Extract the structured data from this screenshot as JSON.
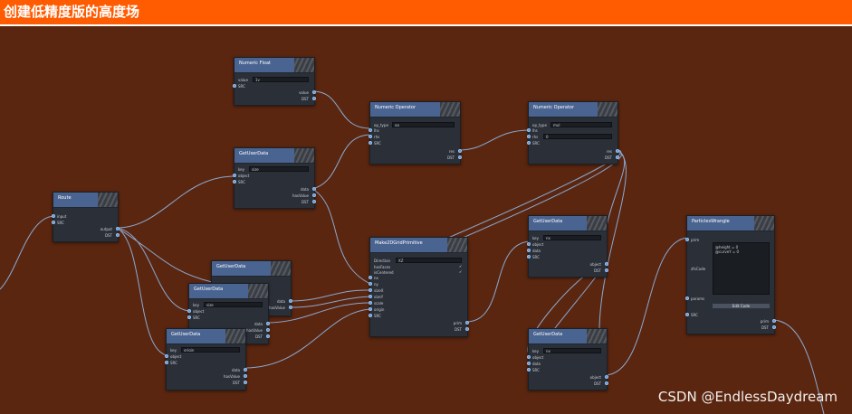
{
  "window": {
    "title": "创建低精度版的高度场"
  },
  "watermark": "CSDN @EndlessDaydream",
  "colors": {
    "titlebar": "#ff5b00",
    "canvas": "#5a2610",
    "node_body": "#2b3038",
    "node_header": "#4a6491",
    "port": "#5b93d6",
    "wire": "#8fb8e8"
  },
  "nodes": {
    "numeric_float": {
      "title": "Numeric Float",
      "inputs": [
        "value",
        "SRC"
      ],
      "value_field": "1y",
      "outputs": [
        "value",
        "DST"
      ]
    },
    "getuserdata_1": {
      "title": "GetUserData",
      "key_label": "key",
      "key_value": "size",
      "inputs": [
        "object",
        "SRC"
      ],
      "outputs": [
        "data",
        "hasValue",
        "DST"
      ]
    },
    "route": {
      "title": "Route",
      "inputs": [
        "input",
        "SRC"
      ],
      "outputs": [
        "output",
        "DST"
      ]
    },
    "numop_1": {
      "title": "Numeric Operator",
      "op_label": "op_type",
      "op_value": "op",
      "inputs": [
        "lhs",
        "rhs",
        "SRC"
      ],
      "outputs": [
        "res",
        "DST"
      ]
    },
    "numop_2": {
      "title": "Numeric Operator",
      "op_label": "op_type",
      "op_value": "mul",
      "inputs": [
        "lhs",
        "rhs",
        "SRC"
      ],
      "rhs_value": "0",
      "outputs": [
        "res",
        "DST"
      ]
    },
    "getuserdata_a": {
      "title": "GetUserData"
    },
    "getuserdata_b": {
      "title": "GetUserData",
      "key_label": "key",
      "key_value": "size",
      "inputs": [
        "object",
        "SRC"
      ],
      "outputs": [
        "data",
        "hasValue",
        "DST"
      ]
    },
    "getuserdata_c": {
      "title": "GetUserData",
      "key_label": "key",
      "key_value": "origin",
      "inputs": [
        "object",
        "SRC"
      ],
      "outputs": [
        "data",
        "hasValue",
        "DST"
      ]
    },
    "getuserdata_a_outputs": [
      "data",
      "hasValue",
      "DST"
    ],
    "grid": {
      "title": "Make2DGridPrimitive",
      "direction_label": "Direction",
      "direction_value": "XZ",
      "checks": [
        "hasFaces",
        "isCentered"
      ],
      "inputs": [
        "nx",
        "ny",
        "sizeX",
        "sizeY",
        "scale",
        "origin",
        "SRC"
      ],
      "outputs": [
        "prim",
        "DST"
      ]
    },
    "getuserdata_d": {
      "title": "GetUserData",
      "key_label": "key",
      "key_value": "nx",
      "inputs": [
        "object",
        "data",
        "SRC"
      ],
      "outputs": [
        "object",
        "DST"
      ]
    },
    "getuserdata_e": {
      "title": "GetUserData",
      "key_label": "key",
      "key_value": "nx",
      "inputs": [
        "object",
        "data",
        "SRC"
      ],
      "outputs": [
        "object",
        "DST"
      ]
    },
    "wrangle": {
      "title": "ParticlesWrangle",
      "inputs": [
        "prim",
        "zfxCode",
        "params",
        "SRC"
      ],
      "code": "@height = 0\n@curveY = 0",
      "edit_label": "Edit Code",
      "outputs": [
        "prim",
        "DST"
      ]
    }
  }
}
